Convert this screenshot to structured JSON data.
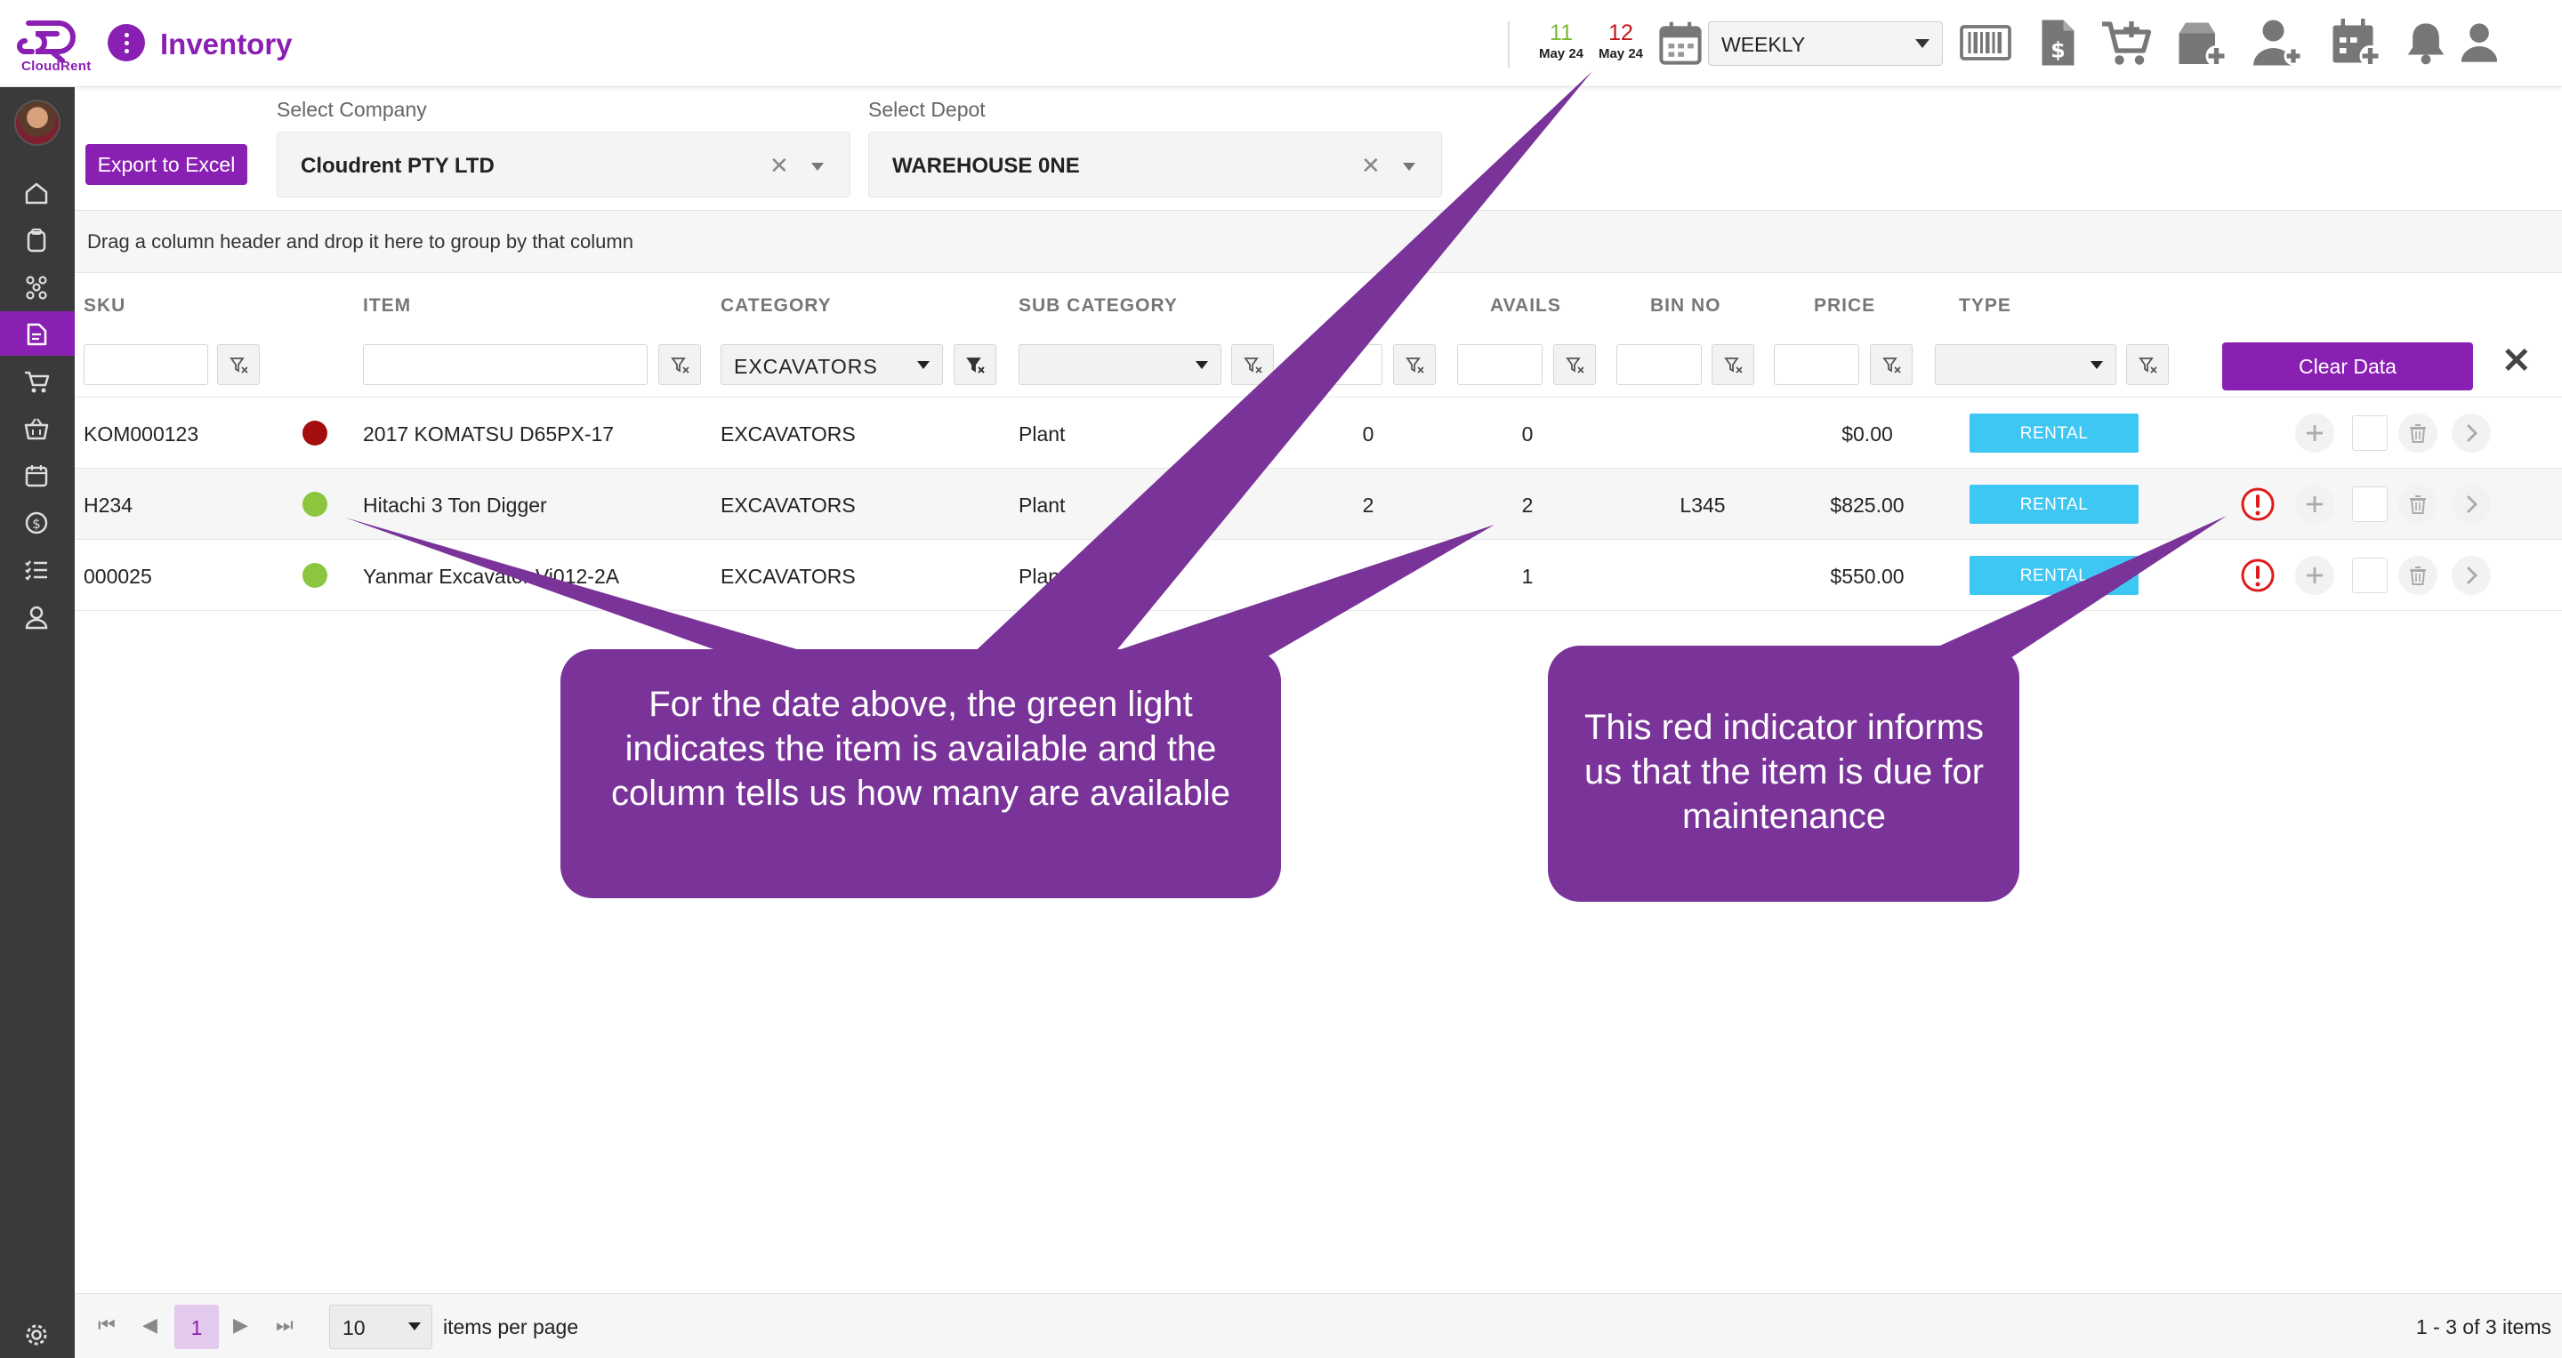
{
  "app": {
    "logo_text": "CloudRent",
    "title": "Inventory"
  },
  "topbar": {
    "dates": [
      {
        "day": "11",
        "month": "May 24",
        "color": "#7cb82f"
      },
      {
        "day": "12",
        "month": "May 24",
        "color": "#c01818"
      }
    ],
    "period": "WEEKLY",
    "icons": [
      "calendar-icon",
      "barcode-icon",
      "invoice-dollar-icon",
      "cart-add-icon",
      "box-add-icon",
      "user-add-icon",
      "calendar-add-icon",
      "bell-icon",
      "user-icon"
    ]
  },
  "sidebar": {
    "icons": [
      "home-icon",
      "clipboard-icon",
      "network-icon",
      "document-icon",
      "cart-icon",
      "basket-icon",
      "calendar-icon",
      "dollar-icon",
      "checklist-icon",
      "user-icon",
      "settings-icon"
    ],
    "active": "document-icon"
  },
  "filters": {
    "export_label": "Export to Excel",
    "company_label": "Select Company",
    "company_value": "Cloudrent PTY LTD",
    "depot_label": "Select Depot",
    "depot_value": "WAREHOUSE 0NE"
  },
  "grid": {
    "group_hint": "Drag a column header and drop it here to group by that column",
    "columns": {
      "sku": "SKU",
      "item": "ITEM",
      "category": "CATEGORY",
      "sub_category": "SUB CATEGORY",
      "avails": "AVAILS",
      "bin_no": "BIN NO",
      "price": "PRICE",
      "type": "TYPE"
    },
    "category_filter": "EXCAVATORS",
    "clear_label": "Clear Data",
    "rows": [
      {
        "sku": "KOM000123",
        "status_color": "#a30d0d",
        "item": "2017 KOMATSU D65PX-17",
        "category": "EXCAVATORS",
        "sub_category": "Plant",
        "qty": "0",
        "avails": "0",
        "bin_no": "",
        "price": "$0.00",
        "type": "RENTAL",
        "maintenance_due": false
      },
      {
        "sku": "H234",
        "status_color": "#8cc63f",
        "item": "Hitachi 3 Ton Digger",
        "category": "EXCAVATORS",
        "sub_category": "Plant",
        "qty": "2",
        "avails": "2",
        "bin_no": "L345",
        "price": "$825.00",
        "type": "RENTAL",
        "maintenance_due": true
      },
      {
        "sku": "000025",
        "status_color": "#8cc63f",
        "item": "Yanmar Excavator Vi012-2A",
        "category": "EXCAVATORS",
        "sub_category": "Plant",
        "qty": "",
        "avails": "1",
        "bin_no": "",
        "price": "$550.00",
        "type": "RENTAL",
        "maintenance_due": true
      }
    ]
  },
  "pager": {
    "current_page": "1",
    "page_size": "10",
    "page_size_label": "items per page",
    "info": "1 - 3 of 3 items"
  },
  "callouts": {
    "availability": "For the date above, the green light indicates the item is available and the column tells us how many are available",
    "maintenance": "This red indicator informs us that the item is due for maintenance"
  },
  "colors": {
    "brand": "#8a1fb3",
    "callout": "#7a3399",
    "rental_tag": "#3fc7f4"
  }
}
